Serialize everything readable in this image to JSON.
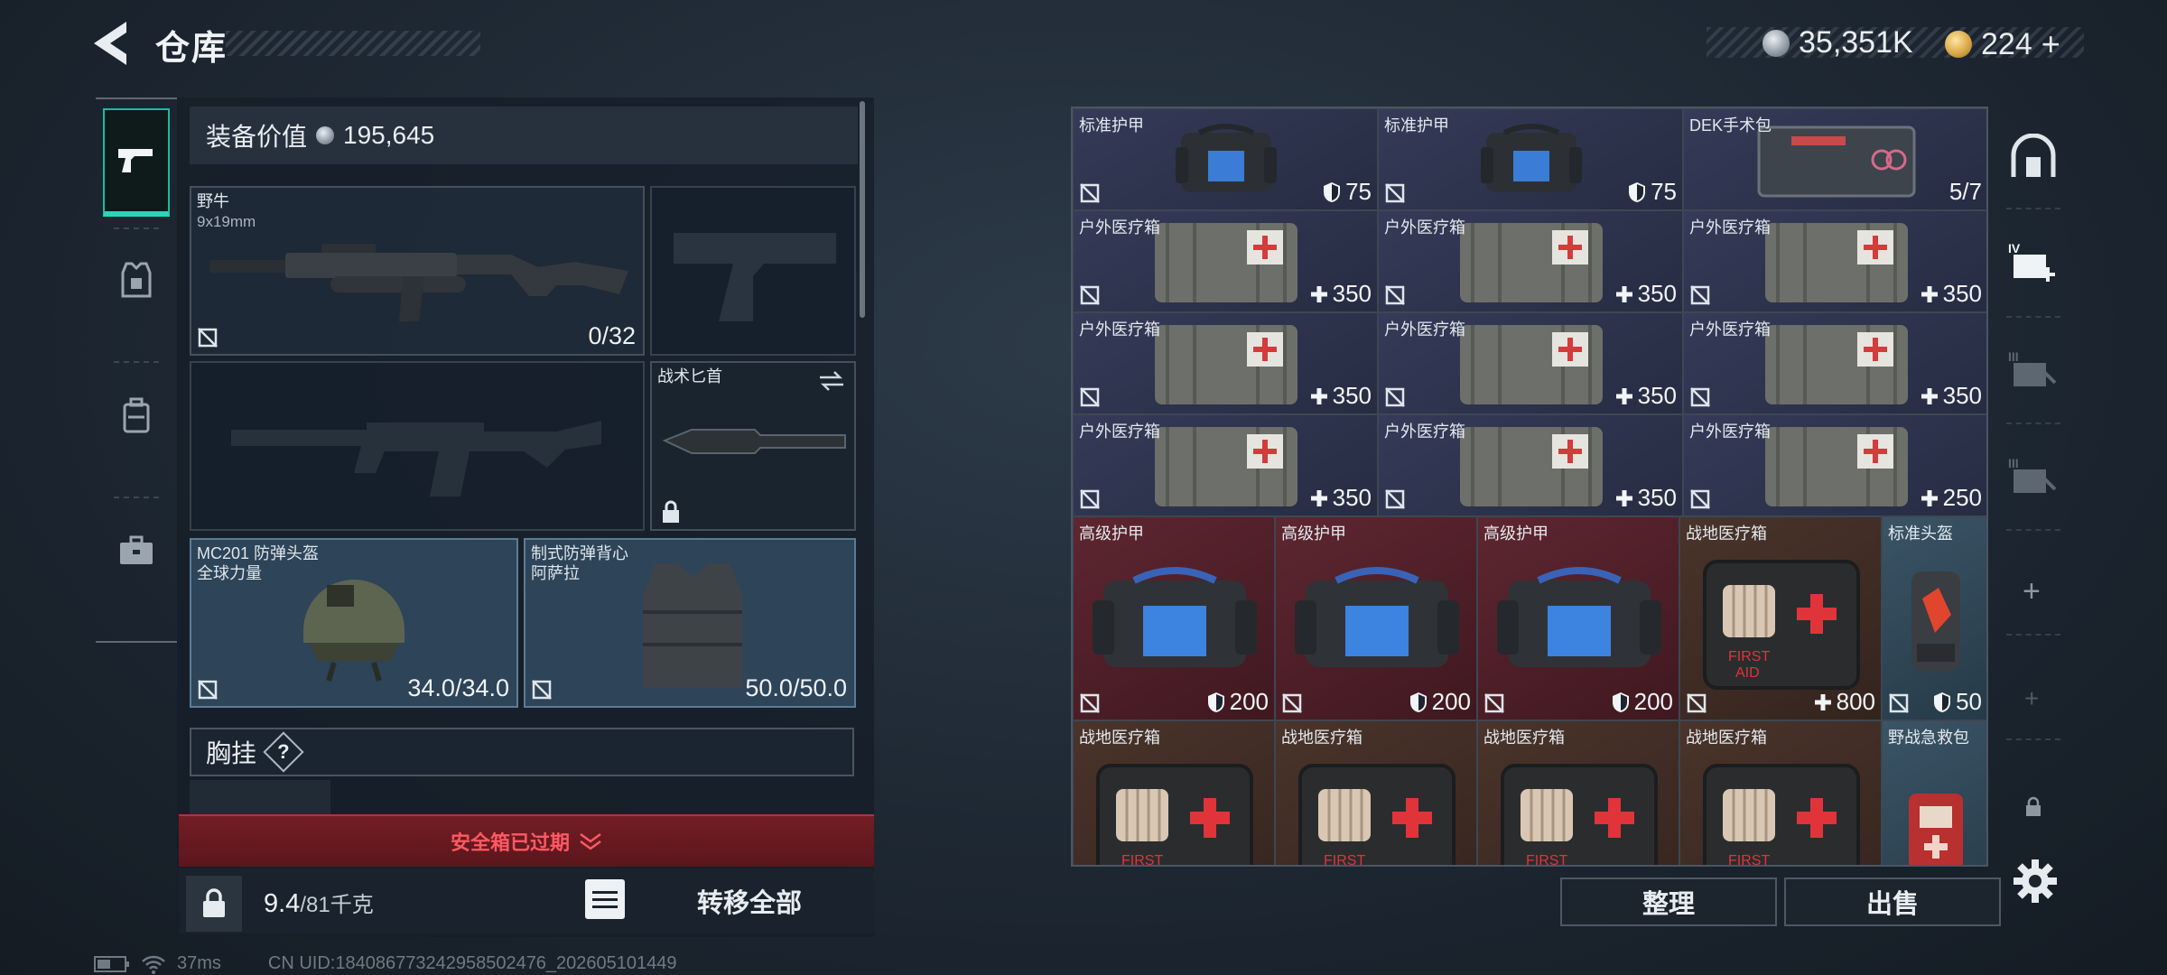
{
  "header": {
    "title": "仓库",
    "currency_silver": "35,351K",
    "currency_gold": "224"
  },
  "loadout": {
    "equipment_value_label": "装备价值",
    "equipment_value": "195,645",
    "primary_weapon": {
      "name": "野牛",
      "caliber": "9x19mm",
      "ammo": "0/32"
    },
    "melee": {
      "name": "战术匕首"
    },
    "helmet": {
      "name": "MC201 防弹头盔",
      "brand": "全球力量",
      "durability": "34.0/34.0"
    },
    "armor": {
      "name": "制式防弹背心",
      "brand": "阿萨拉",
      "durability": "50.0/50.0"
    },
    "chest_rig_label": "胸挂",
    "chest_rig_hint": "?",
    "safebox_expired": "安全箱已过期",
    "weight_current": "9.4",
    "weight_max": "/81千克",
    "transfer_all": "转移全部"
  },
  "storage": {
    "items": [
      {
        "name": "标准护甲",
        "value": "75",
        "icon": "shield-icon",
        "color": "blue",
        "type": "bag"
      },
      {
        "name": "标准护甲",
        "value": "75",
        "icon": "shield-icon",
        "color": "blue",
        "type": "bag"
      },
      {
        "name": "DEK手术包",
        "value": "5/7",
        "icon": "",
        "color": "blue",
        "type": "kit"
      },
      {
        "name": "户外医疗箱",
        "value": "350",
        "icon": "plus-icon",
        "color": "blue",
        "type": "pouch"
      },
      {
        "name": "户外医疗箱",
        "value": "350",
        "icon": "plus-icon",
        "color": "blue",
        "type": "pouch"
      },
      {
        "name": "户外医疗箱",
        "value": "350",
        "icon": "plus-icon",
        "color": "blue",
        "type": "pouch"
      },
      {
        "name": "户外医疗箱",
        "value": "350",
        "icon": "plus-icon",
        "color": "blue",
        "type": "pouch"
      },
      {
        "name": "户外医疗箱",
        "value": "350",
        "icon": "plus-icon",
        "color": "blue",
        "type": "pouch"
      },
      {
        "name": "户外医疗箱",
        "value": "350",
        "icon": "plus-icon",
        "color": "blue",
        "type": "pouch"
      },
      {
        "name": "户外医疗箱",
        "value": "350",
        "icon": "plus-icon",
        "color": "blue",
        "type": "pouch"
      },
      {
        "name": "户外医疗箱",
        "value": "350",
        "icon": "plus-icon",
        "color": "blue",
        "type": "pouch"
      },
      {
        "name": "户外医疗箱",
        "value": "250",
        "icon": "plus-icon",
        "color": "blue",
        "type": "pouch"
      },
      {
        "name": "高级护甲",
        "value": "200",
        "icon": "shield-icon",
        "color": "red",
        "type": "bigbag"
      },
      {
        "name": "高级护甲",
        "value": "200",
        "icon": "shield-icon",
        "color": "red",
        "type": "bigbag"
      },
      {
        "name": "高级护甲",
        "value": "200",
        "icon": "shield-icon",
        "color": "red",
        "type": "bigbag"
      },
      {
        "name": "战地医疗箱",
        "value": "800",
        "icon": "plus-icon",
        "color": "brown",
        "type": "firstaid"
      },
      {
        "name": "标准头盔",
        "value": "50",
        "icon": "shield-icon",
        "color": "teal",
        "type": "helmetitem"
      },
      {
        "name": "战地医疗箱",
        "value": "",
        "icon": "",
        "color": "brown",
        "type": "firstaid"
      },
      {
        "name": "战地医疗箱",
        "value": "",
        "icon": "",
        "color": "brown",
        "type": "firstaid"
      },
      {
        "name": "战地医疗箱",
        "value": "",
        "icon": "",
        "color": "brown",
        "type": "firstaid"
      },
      {
        "name": "战地医疗箱",
        "value": "",
        "icon": "",
        "color": "brown",
        "type": "firstaid"
      },
      {
        "name": "野战急救包",
        "value": "",
        "icon": "",
        "color": "teal",
        "type": "smallkit"
      }
    ],
    "sort_label": "整理",
    "sell_label": "出售",
    "side_tab_roman": [
      "IV",
      "III",
      "III"
    ]
  },
  "status_bar": {
    "ping": "37ms",
    "uid": "CN UID:18408677324295850​2476_202605101449"
  },
  "colors": {
    "accent_teal": "#2ad6b8",
    "expired_red": "#ff5964",
    "item_blue": "#2c3350",
    "item_red": "#5a2430",
    "item_brown": "#46302a"
  }
}
